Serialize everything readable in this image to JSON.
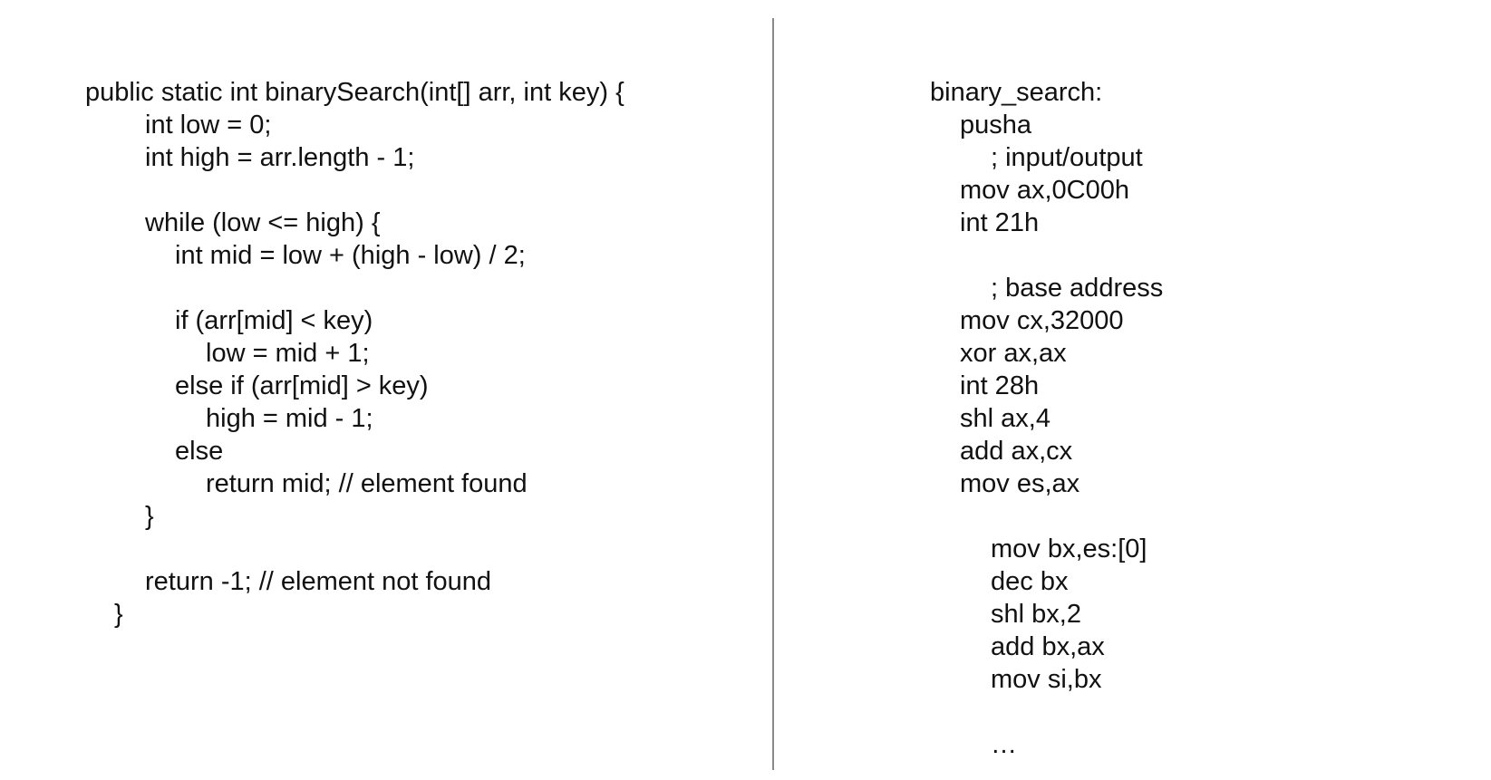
{
  "java_code": {
    "line1": "public static int binarySearch(int[] arr, int key) {",
    "line2": "int low = 0;",
    "line3": "int high = arr.length - 1;",
    "line4": "while (low <= high) {",
    "line5": "int mid = low + (high - low) / 2;",
    "line6": "if (arr[mid] < key)",
    "line7": "low = mid + 1;",
    "line8": "else if (arr[mid] > key)",
    "line9": "high = mid - 1;",
    "line10": "else",
    "line11": "return mid; // element found",
    "line12": "}",
    "line13": "return -1; // element not found",
    "line14": "}"
  },
  "asm_code": {
    "line1": "binary_search:",
    "line2": "pusha",
    "line3": "; input/output",
    "line4": "mov ax,0C00h",
    "line5": "int 21h",
    "line6": "; base address",
    "line7": "mov cx,32000",
    "line8": "xor ax,ax",
    "line9": "int 28h",
    "line10": "shl ax,4",
    "line11": "add ax,cx",
    "line12": "mov es,ax",
    "line13": "mov bx,es:[0]",
    "line14": "dec bx",
    "line15": "shl bx,2",
    "line16": "add bx,ax",
    "line17": "mov si,bx",
    "line18": "…"
  }
}
